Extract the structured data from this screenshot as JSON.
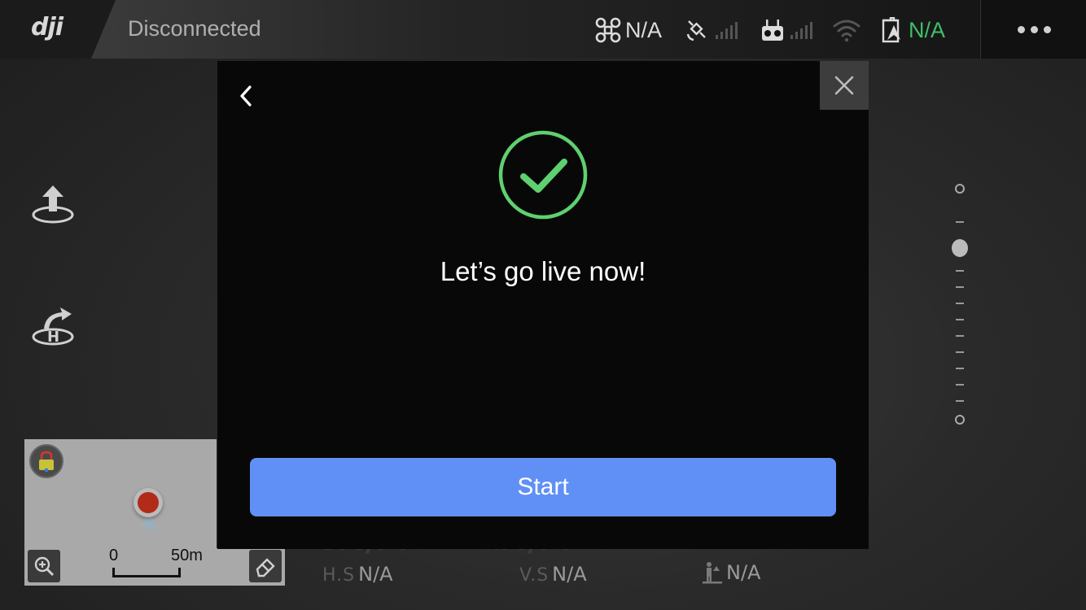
{
  "topbar": {
    "logo": "dji",
    "connection_status": "Disconnected",
    "aircraft": {
      "icon": "drone-icon",
      "value": "N/A"
    },
    "gps": {
      "icon": "satellite-icon"
    },
    "remote": {
      "icon": "remote-controller-icon"
    },
    "wifi": {
      "icon": "wifi-icon"
    },
    "battery": {
      "icon": "battery-icon",
      "value": "N/A",
      "color": "#3fbf6a"
    },
    "more_icon": "more-dots-icon"
  },
  "left_tools": [
    {
      "name": "takeoff-button",
      "icon": "takeoff-icon"
    },
    {
      "name": "return-home-button",
      "icon": "return-home-icon"
    }
  ],
  "slider": {
    "level": 0.25
  },
  "minimap": {
    "lock_icon": "lock-icon",
    "zoom_icon": "zoom-in-icon",
    "erase_icon": "eraser-icon",
    "scale_start": "0",
    "scale_end": "50m"
  },
  "telemetry": {
    "distance": {
      "label": "D",
      "value": "N/A"
    },
    "height": {
      "label": "H",
      "value": "N/A"
    },
    "hspeed": {
      "label": "H.S",
      "value": "N/A"
    },
    "vspeed": {
      "label": "V.S",
      "value": "N/A"
    },
    "vps": {
      "icon": "vps-height-icon",
      "value": "N/A"
    }
  },
  "modal": {
    "back_icon": "chevron-left-icon",
    "close_icon": "close-icon",
    "success_icon": "check-circle-icon",
    "message": "Let’s go live now!",
    "start_label": "Start",
    "accent": "#6090f5",
    "success_color": "#5fd06f"
  }
}
